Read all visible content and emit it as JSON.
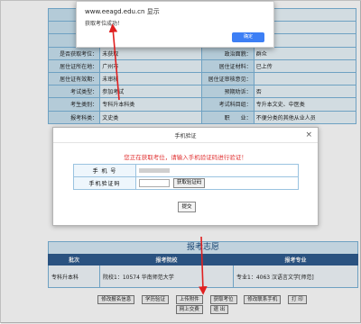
{
  "info_rows": [
    [
      "姓",
      "",
      "",
      ""
    ],
    [
      "性",
      "",
      "",
      ""
    ],
    [
      "户口所",
      "",
      "",
      ""
    ],
    [
      "是否获取考位：",
      "未获取",
      "政治面貌：",
      "群众"
    ],
    [
      "居住证所在地：",
      "广州市",
      "居住证材料：",
      "已上传"
    ],
    [
      "居住证有效期：",
      "未审核",
      "居住证审核意见：",
      ""
    ],
    [
      "考试类型：",
      "参加考试",
      "预期劝诉：",
      "否"
    ],
    [
      "考生类别：",
      "专科升本科类",
      "考试科目组：",
      "专升本文史、中医类"
    ],
    [
      "报考科类：",
      "文史类",
      "职　　业：",
      "不便分类的其他从业人员"
    ]
  ],
  "alert": {
    "title": "www.eeagd.edu.cn 显示",
    "message": "获取考位成功！",
    "ok_label": "确定"
  },
  "modal": {
    "title": "手机验证",
    "close": "×",
    "tip": "您正在获取考位，请输入手机验证码进行验证！",
    "phone_label": "手 机 号",
    "code_label": "手机验证码",
    "get_code_label": "获取验证码",
    "submit_label": "提交"
  },
  "report": {
    "title": "报考志愿",
    "headers": [
      "批次",
      "报考院校",
      "报考专业"
    ],
    "rows": [
      [
        "专科升本科",
        "院校1：10574  华南师范大学",
        "专业1：4063 汉语言文学[师范]"
      ]
    ]
  },
  "buttons": {
    "row1": [
      "修改报名信息",
      "学历验证",
      "上传附件",
      "获取考位",
      "修改联系手机",
      "打 印"
    ],
    "row2": [
      "网上交费",
      "退 出"
    ]
  },
  "colors": {
    "accent": "#3d7ff5",
    "header": "#2f5c8f",
    "arrow": "#e02020",
    "tip": "#e03030"
  }
}
